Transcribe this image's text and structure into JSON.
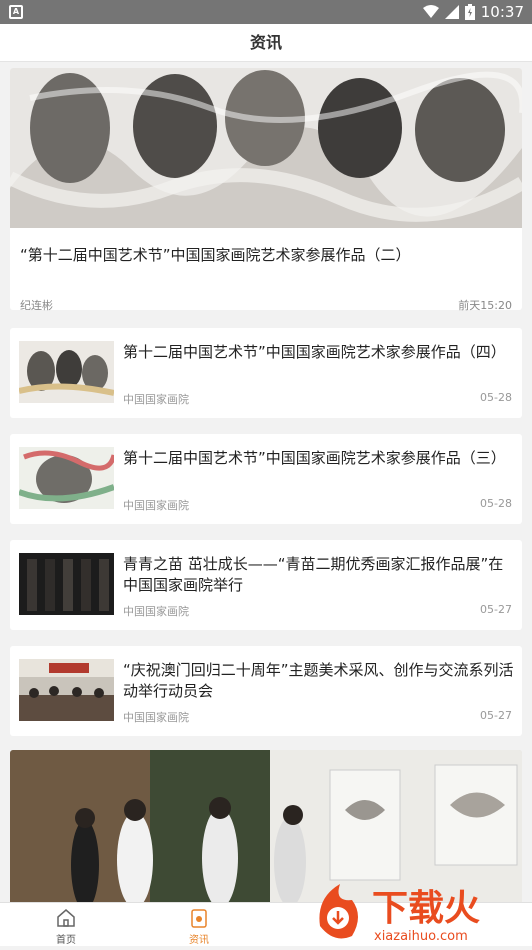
{
  "status": {
    "time": "10:37",
    "left_icon": "A"
  },
  "header": {
    "title": "资讯"
  },
  "feature": {
    "title": "“第十二届中国艺术节”中国国家画院艺术家参展作品（二）",
    "author": "纪连彬",
    "date": "前天15:20"
  },
  "articles": [
    {
      "title": "第十二届中国艺术节”中国国家画院艺术家参展作品（四）",
      "source": "中国国家画院",
      "date": "05-28"
    },
    {
      "title": "第十二届中国艺术节”中国国家画院艺术家参展作品（三）",
      "source": "中国国家画院",
      "date": "05-28"
    },
    {
      "title": "青青之苗 茁壮成长——“青苗二期优秀画家汇报作品展”在中国国家画院举行",
      "source": "中国国家画院",
      "date": "05-27"
    },
    {
      "title": "“庆祝澳门回归二十周年”主题美术采风、创作与交流系列活动举行动员会",
      "source": "中国国家画院",
      "date": "05-27"
    }
  ],
  "tabs": [
    {
      "label": "首页"
    },
    {
      "label": "资讯"
    }
  ],
  "watermark": {
    "text": "下载火",
    "url": "xiazaihuo.com"
  },
  "colors": {
    "accent": "#e8842a",
    "status_bar": "#757575",
    "watermark": "#e94c1f"
  }
}
